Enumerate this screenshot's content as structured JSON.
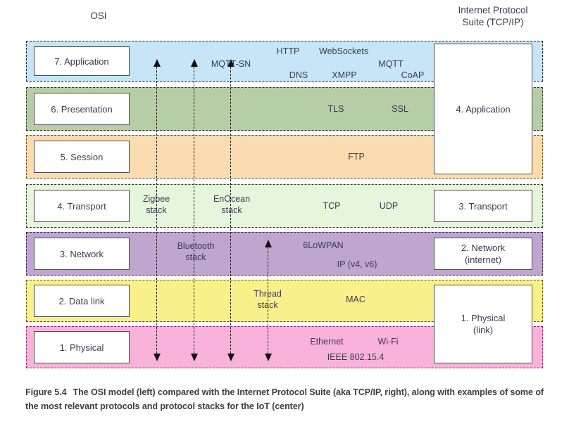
{
  "figure": {
    "caption_number": "Figure 5.4",
    "caption_text": "The OSI model (left) compared with the Internet Protocol Suite (aka TCP/IP, right), along with examples of some of the most relevant protocols and protocol stacks for the IoT (center)"
  },
  "headings": {
    "left": "OSI",
    "right": "Internet Protocol\nSuite (TCP/IP)"
  },
  "colors": {
    "application": "#c6e6f7",
    "presentation": "#b7cda5",
    "session": "#fbdcb0",
    "transport": "#e6f6dd",
    "network": "#bfa6cf",
    "datalink": "#faf08a",
    "physical": "#f9b2da"
  },
  "osi_layers": [
    {
      "label": "7. Application"
    },
    {
      "label": "6. Presentation"
    },
    {
      "label": "5. Session"
    },
    {
      "label": "4. Transport"
    },
    {
      "label": "3. Network"
    },
    {
      "label": "2. Data link"
    },
    {
      "label": "1. Physical"
    }
  ],
  "tcpip_layers": [
    {
      "label": "4. Application"
    },
    {
      "label": "3. Transport"
    },
    {
      "label": "2. Network\n(internet)"
    },
    {
      "label": "1. Physical\n(link)"
    }
  ],
  "protocols": [
    {
      "name": "HTTP"
    },
    {
      "name": "WebSockets"
    },
    {
      "name": "MQTT-SN"
    },
    {
      "name": "DNS"
    },
    {
      "name": "XMPP"
    },
    {
      "name": "MQTT"
    },
    {
      "name": "CoAP"
    },
    {
      "name": "TLS"
    },
    {
      "name": "SSL"
    },
    {
      "name": "FTP"
    },
    {
      "name": "TCP"
    },
    {
      "name": "UDP"
    },
    {
      "name": "6LoWPAN"
    },
    {
      "name": "IP (v4, v6)"
    },
    {
      "name": "MAC"
    },
    {
      "name": "Ethernet"
    },
    {
      "name": "Wi-Fi"
    },
    {
      "name": "IEEE 802.15.4"
    }
  ],
  "stacks": [
    {
      "name": "Zigbee\nstack"
    },
    {
      "name": "EnOcean\nstack"
    },
    {
      "name": "Bluetooth\nstack"
    },
    {
      "name": "Thread\nstack"
    }
  ]
}
